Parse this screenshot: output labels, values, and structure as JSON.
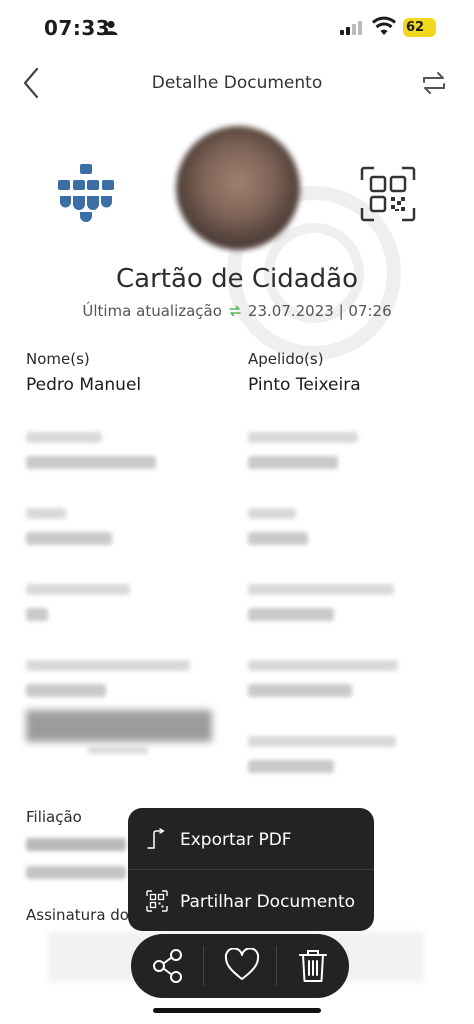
{
  "status_bar": {
    "time": "07:33",
    "battery": "62"
  },
  "nav": {
    "title": "Detalhe Documento"
  },
  "header": {
    "title": "Cartão de Cidadão",
    "updated_label": "Última atualização",
    "updated_value": "23.07.2023 | 07:26"
  },
  "fields": {
    "names_label": "Nome(s)",
    "names_value": "Pedro Manuel",
    "surname_label": "Apelido(s)",
    "surname_value": "Pinto Teixeira"
  },
  "sections": {
    "filiation_label": "Filiação",
    "signature_label": "Assinatura do"
  },
  "menu": {
    "export_label": "Exportar PDF",
    "share_label": "Partilhar Documento"
  },
  "actions": [
    "share-icon",
    "heart-icon",
    "trash-icon"
  ],
  "colors": {
    "accent": "#3a6ea5",
    "sync": "#5cb85c",
    "menu_bg": "#232323"
  }
}
